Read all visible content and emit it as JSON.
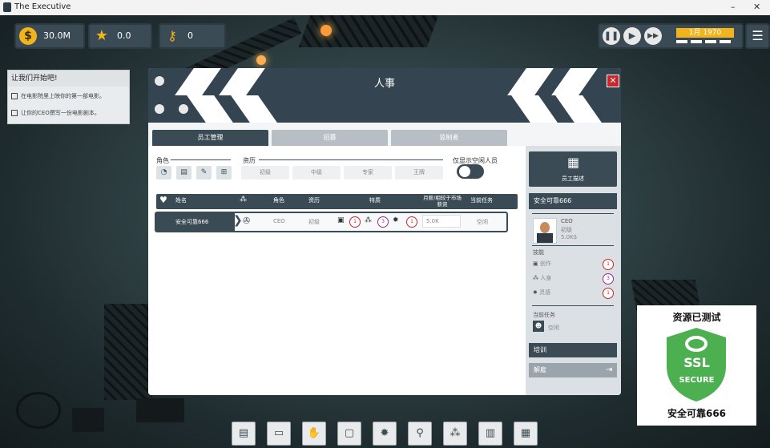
{
  "window": {
    "title": "The Executive",
    "min": "–",
    "max": "☐",
    "close": "✕"
  },
  "hud": {
    "money": {
      "icon": "dollar-icon",
      "value": "30.0M"
    },
    "prestige": {
      "icon": "star-icon",
      "value": "0.0"
    },
    "research": {
      "icon": "key-icon",
      "value": "0"
    },
    "date": "1月 1970"
  },
  "mission": {
    "title": "让我们开始吧!",
    "tasks": [
      "在电影院里上映你的第一部电影。",
      "让你的CEO撰写一份电影剧本。"
    ]
  },
  "dialog": {
    "title": "人事",
    "close": "✕",
    "tabs": [
      "员工管理",
      "招募",
      "监制者"
    ],
    "filters": {
      "role_label": "角色",
      "experience_label": "资历",
      "experience_options": [
        "初级",
        "中级",
        "专家",
        "王牌"
      ],
      "unassigned_label": "仅显示空闲人员"
    },
    "table": {
      "headers": {
        "name": "姓名",
        "role": "角色",
        "experience": "资历",
        "traits": "特质",
        "salary": "月薪/相较于市场薪资",
        "task": "当前任务"
      },
      "rows": [
        {
          "name": "安全可靠666",
          "role": "CEO",
          "experience": "初级",
          "salary": "5.0K",
          "task": "空闲",
          "trait_scores": [
            "1",
            "3",
            "1"
          ]
        }
      ]
    }
  },
  "side": {
    "description_button": "员工描述",
    "employee_name": "安全可靠666",
    "role": "CEO",
    "level": "初级",
    "salary": "5.0K$",
    "skills_label": "技能",
    "skills": [
      {
        "name": "创作",
        "score": "1",
        "color": "#c8262b"
      },
      {
        "name": "人身",
        "score": "3",
        "color": "#9b2a8a"
      },
      {
        "name": "灵感",
        "score": "1",
        "color": "#c8262b"
      }
    ],
    "task_label": "当前任务",
    "task_value": "空闲",
    "train_button": "培训",
    "fire_button": "解雇"
  },
  "ssl": {
    "title": "资源已测试",
    "shield_top": "SSL",
    "shield_bottom": "SECURE",
    "footer": "安全可靠666"
  },
  "bottom_bar": [
    "film-icon",
    "folder-icon",
    "handshake-icon",
    "tv-icon",
    "lightbulb-icon",
    "magnifier-icon",
    "people-icon",
    "chart-icon",
    "building-icon"
  ]
}
